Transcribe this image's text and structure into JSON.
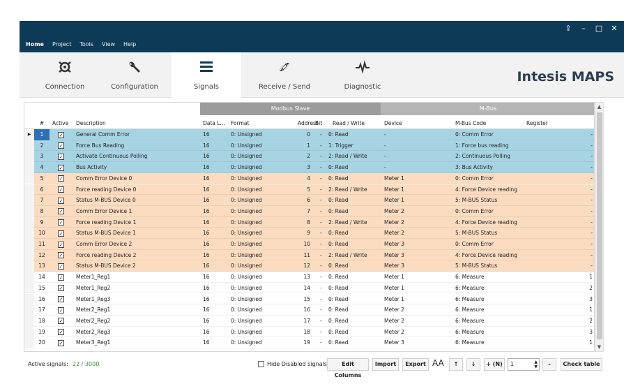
{
  "titlebar": {
    "menu": [
      "Home",
      "Project",
      "Tools",
      "View",
      "Help"
    ],
    "controls": [
      "⇪",
      "–",
      "□",
      "✕"
    ]
  },
  "ribbon": {
    "tabs": [
      {
        "label": "Connection",
        "icon": "connection-icon"
      },
      {
        "label": "Configuration",
        "icon": "wrench-icon"
      },
      {
        "label": "Signals",
        "icon": "list-icon"
      },
      {
        "label": "Receive / Send",
        "icon": "transfer-icon"
      },
      {
        "label": "Diagnostic",
        "icon": "pulse-icon"
      }
    ],
    "selected": "Signals",
    "brand": "Intesis MAPS"
  },
  "grid": {
    "groups": {
      "modbus": "Modbus Slave",
      "mbus": "M-Bus"
    },
    "columns": {
      "num": "#",
      "active": "Active",
      "description": "Description",
      "data_len": "Data L...",
      "format": "Format",
      "address": "Address",
      "bit": "Bit",
      "rw": "Read / Write",
      "device": "Device",
      "mbus_code": "M-Bus Code",
      "register": "Register"
    },
    "colors": {
      "group_dark": "#9c9c9c",
      "group_light": "#b5b5b5",
      "blue": "#a7d4e3",
      "orange": "#fbdcc0",
      "white": "#ffffff"
    },
    "rows": [
      {
        "n": "1",
        "desc": "General Comm Error",
        "dl": "16",
        "fmt": "0: Unsigned",
        "addr": "0",
        "bit": "-",
        "rw": "0: Read",
        "dev": "-",
        "code": "0: Comm Error",
        "reg": "-",
        "color": "blue"
      },
      {
        "n": "2",
        "desc": "Force Bus Reading",
        "dl": "16",
        "fmt": "0: Unsigned",
        "addr": "1",
        "bit": "-",
        "rw": "1: Trigger",
        "dev": "-",
        "code": "1: Force bus reading",
        "reg": "-",
        "color": "blue"
      },
      {
        "n": "3",
        "desc": "Activate Continuous Polling",
        "dl": "16",
        "fmt": "0: Unsigned",
        "addr": "2",
        "bit": "-",
        "rw": "2: Read / Write",
        "dev": "-",
        "code": "2: Continuous Polling",
        "reg": "-",
        "color": "blue"
      },
      {
        "n": "4",
        "desc": "Bus Activity",
        "dl": "16",
        "fmt": "0: Unsigned",
        "addr": "3",
        "bit": "-",
        "rw": "0: Read",
        "dev": "-",
        "code": "3: Bus Activity",
        "reg": "-",
        "color": "blue"
      },
      {
        "n": "5",
        "desc": "Comm Error Device 0",
        "dl": "16",
        "fmt": "0: Unsigned",
        "addr": "4",
        "bit": "-",
        "rw": "0: Read",
        "dev": "Meter 1",
        "code": "0: Comm Error",
        "reg": "-",
        "color": "orange"
      },
      {
        "n": "6",
        "desc": "Force reading Device 0",
        "dl": "16",
        "fmt": "0: Unsigned",
        "addr": "5",
        "bit": "-",
        "rw": "2: Read / Write",
        "dev": "Meter 1",
        "code": "4: Force Device reading",
        "reg": "-",
        "color": "orange"
      },
      {
        "n": "7",
        "desc": "Status M-BUS Device 0",
        "dl": "16",
        "fmt": "0: Unsigned",
        "addr": "6",
        "bit": "-",
        "rw": "0: Read",
        "dev": "Meter 1",
        "code": "5: M-BUS Status",
        "reg": "-",
        "color": "orange"
      },
      {
        "n": "8",
        "desc": "Comm Error Device 1",
        "dl": "16",
        "fmt": "0: Unsigned",
        "addr": "7",
        "bit": "-",
        "rw": "0: Read",
        "dev": "Meter 2",
        "code": "0: Comm Error",
        "reg": "-",
        "color": "orange"
      },
      {
        "n": "9",
        "desc": "Force reading Device 1",
        "dl": "16",
        "fmt": "0: Unsigned",
        "addr": "8",
        "bit": "-",
        "rw": "2: Read / Write",
        "dev": "Meter 2",
        "code": "4: Force Device reading",
        "reg": "-",
        "color": "orange"
      },
      {
        "n": "10",
        "desc": "Status M-BUS Device 1",
        "dl": "16",
        "fmt": "0: Unsigned",
        "addr": "9",
        "bit": "-",
        "rw": "0: Read",
        "dev": "Meter 2",
        "code": "5: M-BUS Status",
        "reg": "-",
        "color": "orange"
      },
      {
        "n": "11",
        "desc": "Comm Error Device 2",
        "dl": "16",
        "fmt": "0: Unsigned",
        "addr": "10",
        "bit": "-",
        "rw": "0: Read",
        "dev": "Meter 3",
        "code": "0: Comm Error",
        "reg": "-",
        "color": "orange"
      },
      {
        "n": "12",
        "desc": "Force reading Device 2",
        "dl": "16",
        "fmt": "0: Unsigned",
        "addr": "11",
        "bit": "-",
        "rw": "2: Read / Write",
        "dev": "Meter 3",
        "code": "4: Force Device reading",
        "reg": "-",
        "color": "orange"
      },
      {
        "n": "13",
        "desc": "Status M-BUS Device 2",
        "dl": "16",
        "fmt": "0: Unsigned",
        "addr": "12",
        "bit": "-",
        "rw": "0: Read",
        "dev": "Meter 3",
        "code": "5: M-BUS Status",
        "reg": "-",
        "color": "orange"
      },
      {
        "n": "14",
        "desc": "Meter1_Reg1",
        "dl": "16",
        "fmt": "0: Unsigned",
        "addr": "13",
        "bit": "-",
        "rw": "0: Read",
        "dev": "Meter 1",
        "code": "6: Measure",
        "reg": "1",
        "color": "white"
      },
      {
        "n": "15",
        "desc": "Meter1_Reg2",
        "dl": "16",
        "fmt": "0: Unsigned",
        "addr": "14",
        "bit": "-",
        "rw": "0: Read",
        "dev": "Meter 1",
        "code": "6: Measure",
        "reg": "2",
        "color": "white"
      },
      {
        "n": "16",
        "desc": "Meter1_Reg3",
        "dl": "16",
        "fmt": "0: Unsigned",
        "addr": "15",
        "bit": "-",
        "rw": "0: Read",
        "dev": "Meter 1",
        "code": "6: Measure",
        "reg": "3",
        "color": "white"
      },
      {
        "n": "17",
        "desc": "Meter2_Reg1",
        "dl": "16",
        "fmt": "0: Unsigned",
        "addr": "16",
        "bit": "-",
        "rw": "0: Read",
        "dev": "Meter 2",
        "code": "6: Measure",
        "reg": "1",
        "color": "white"
      },
      {
        "n": "18",
        "desc": "Meter2_Reg2",
        "dl": "16",
        "fmt": "0: Unsigned",
        "addr": "17",
        "bit": "-",
        "rw": "0: Read",
        "dev": "Meter 2",
        "code": "6: Measure",
        "reg": "2",
        "color": "white"
      },
      {
        "n": "19",
        "desc": "Meter2_Reg3",
        "dl": "16",
        "fmt": "0: Unsigned",
        "addr": "18",
        "bit": "-",
        "rw": "0: Read",
        "dev": "Meter 2",
        "code": "6: Measure",
        "reg": "3",
        "color": "white"
      },
      {
        "n": "20",
        "desc": "Meter3_Reg1",
        "dl": "16",
        "fmt": "0: Unsigned",
        "addr": "19",
        "bit": "-",
        "rw": "0: Read",
        "dev": "Meter 3",
        "code": "6: Measure",
        "reg": "1",
        "color": "white"
      }
    ]
  },
  "footer": {
    "active_label": "Active signals:",
    "active_value": "22 / 3000",
    "hide_disabled": "Hide Disabled signals",
    "edit_columns": "Edit Columns",
    "import": "Import",
    "export": "Export",
    "font_size": "AA",
    "up": "↑",
    "down": "↓",
    "add_n": "+ (N)",
    "n_value": "1",
    "minus": "-",
    "check_table": "Check table"
  }
}
